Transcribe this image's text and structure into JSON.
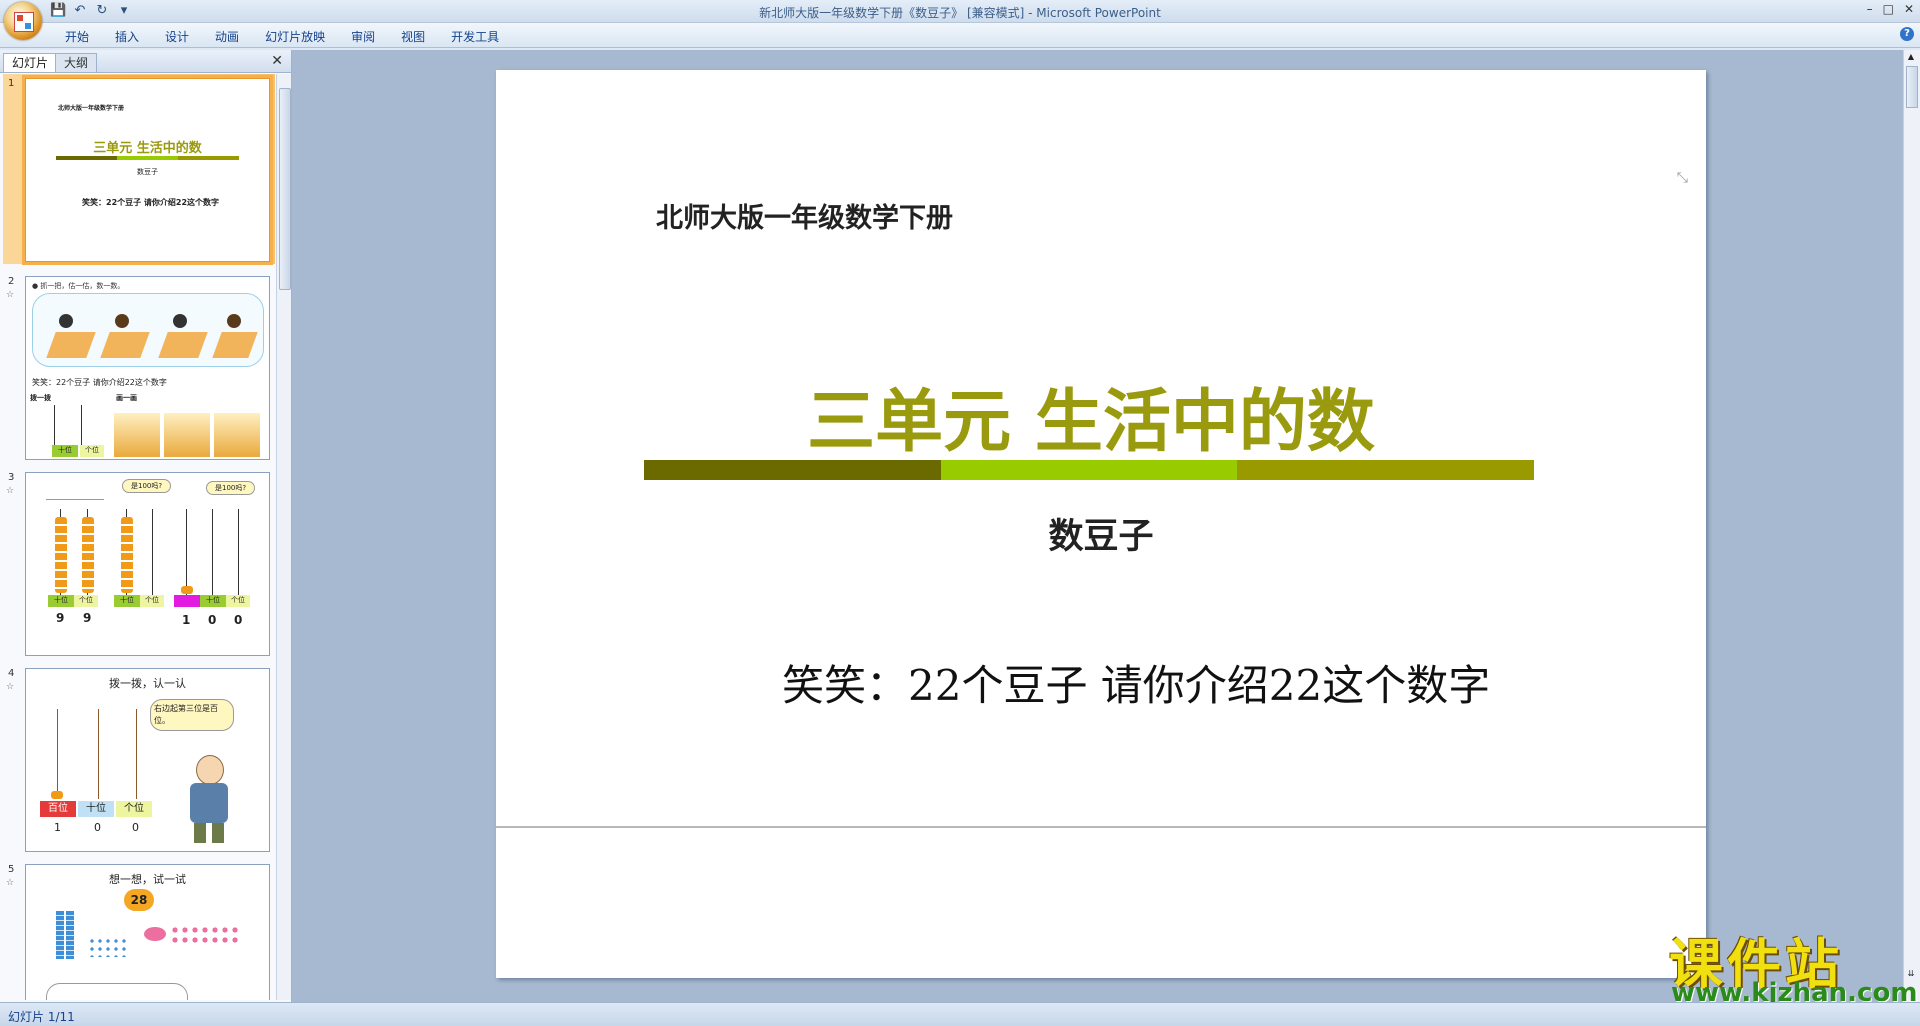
{
  "window": {
    "title": "新北师大版一年级数学下册《数豆子》 [兼容模式] - Microsoft PowerPoint",
    "controls": [
      "–",
      "□",
      "✕"
    ]
  },
  "ribbon": {
    "tabs": [
      "开始",
      "插入",
      "设计",
      "动画",
      "幻灯片放映",
      "审阅",
      "视图",
      "开发工具"
    ]
  },
  "pane": {
    "tabs": [
      "幻灯片",
      "大纲"
    ],
    "close": "✕"
  },
  "thumbnails": [
    {
      "num": "1",
      "sub": "北师大版一年级数学下册",
      "title": "三单元  生活中的数",
      "caption": "数豆子",
      "body": "笑笑：22个豆子  请你介绍22这个数字"
    },
    {
      "num": "2",
      "heading": "● 抓一把，估一估，数一数。",
      "body": "笑笑：22个豆子  请你介绍22这个数字",
      "labels": [
        "拨一拨",
        "画一画",
        "十位",
        "个位"
      ]
    },
    {
      "num": "3",
      "bubbles": [
        "是100吗?",
        "是100吗?"
      ],
      "labels": [
        "十位",
        "个位",
        "十位",
        "个位",
        "十位",
        "个位"
      ],
      "digits": [
        "9",
        "9",
        "1",
        "0",
        "0"
      ]
    },
    {
      "num": "4",
      "heading": "拨一拨，认一认",
      "bubble": "右边起第三位是百位。",
      "labels": [
        "百位",
        "十位",
        "个位"
      ],
      "digits": [
        "1",
        "0",
        "0"
      ]
    },
    {
      "num": "5",
      "heading": "想一想，试一试",
      "number": "28"
    }
  ],
  "slide": {
    "subtitle": "北师大版一年级数学下册",
    "title": "三单元  生活中的数",
    "caption": "数豆子",
    "body": "笑笑：22个豆子  请你介绍22这个数字",
    "bar_colors": [
      "#6b6a00",
      "#99cc00",
      "#999900"
    ]
  },
  "status": {
    "slide_counter": "幻灯片 1/11"
  },
  "watermark": {
    "text": "课件站",
    "url": "www.kjzhan.com"
  }
}
